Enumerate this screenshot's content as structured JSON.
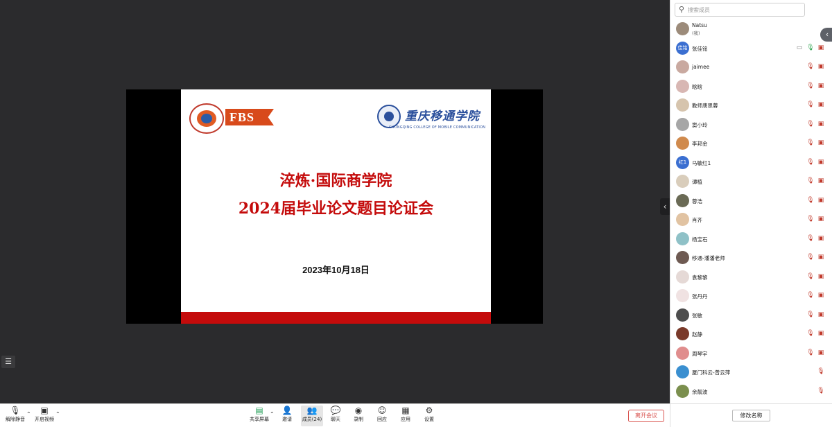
{
  "slide": {
    "fbs_logo_text": "FBS",
    "college_name": "重庆移通学院",
    "college_subtitle": "CHONGQING COLLEGE OF MOBILE COMMUNICATION",
    "title_line1": "淬炼·国际商学院",
    "title_line2": "2024届毕业论文题目论证会",
    "date": "2023年10月18日"
  },
  "panel": {
    "search_placeholder": "搜索成员",
    "members": [
      {
        "name": "Natsu",
        "sub": "(我)",
        "avatar_text": "",
        "avatar_color": "#9c8b7a",
        "mic": "none",
        "cam": "none"
      },
      {
        "name": "张佳铭",
        "avatar_text": "佳铭",
        "avatar_color": "#3b6fd1",
        "mic": "on",
        "cam": "off",
        "share": "screen-icon"
      },
      {
        "name": "jaimee",
        "avatar_text": "",
        "avatar_color": "#c9a9a0",
        "mic": "off",
        "cam": "off"
      },
      {
        "name": "晗晗",
        "avatar_text": "",
        "avatar_color": "#d8b7b3",
        "mic": "off",
        "cam": "off"
      },
      {
        "name": "教师唐思蓉",
        "avatar_text": "",
        "avatar_color": "#d6c4ad",
        "mic": "off",
        "cam": "off"
      },
      {
        "name": "窦小玲",
        "avatar_text": "",
        "avatar_color": "#a6a6a6",
        "mic": "off",
        "cam": "off"
      },
      {
        "name": "李邦金",
        "avatar_text": "",
        "avatar_color": "#d08a4d",
        "mic": "off",
        "cam": "off"
      },
      {
        "name": "马敏红1",
        "avatar_text": "红1",
        "avatar_color": "#3b6fd1",
        "mic": "off",
        "cam": "off"
      },
      {
        "name": "谭植",
        "avatar_text": "",
        "avatar_color": "#d9cdbb",
        "mic": "off",
        "cam": "off"
      },
      {
        "name": "蓉浩",
        "avatar_text": "",
        "avatar_color": "#6a6a55",
        "mic": "off",
        "cam": "off"
      },
      {
        "name": "肖齐",
        "avatar_text": "",
        "avatar_color": "#e1c3a2",
        "mic": "off",
        "cam": "off"
      },
      {
        "name": "杨宝石",
        "avatar_text": "",
        "avatar_color": "#8fc1c7",
        "mic": "off",
        "cam": "off"
      },
      {
        "name": "移通-潘潘老师",
        "avatar_text": "",
        "avatar_color": "#6e5a52",
        "mic": "off",
        "cam": "off"
      },
      {
        "name": "袁黎黎",
        "avatar_text": "",
        "avatar_color": "#e5d9d6",
        "mic": "off",
        "cam": "off"
      },
      {
        "name": "张丹丹",
        "avatar_text": "",
        "avatar_color": "#f0e2e2",
        "mic": "off",
        "cam": "off"
      },
      {
        "name": "张敏",
        "avatar_text": "",
        "avatar_color": "#4d4d4d",
        "mic": "off",
        "cam": "off"
      },
      {
        "name": "赵静",
        "avatar_text": "",
        "avatar_color": "#7a3a2a",
        "mic": "off",
        "cam": "off"
      },
      {
        "name": "周琴宇",
        "avatar_text": "",
        "avatar_color": "#e08d8d",
        "mic": "off",
        "cam": "off"
      },
      {
        "name": "厦门科云-曾云萍",
        "avatar_text": "",
        "avatar_color": "#3a8fd0",
        "mic": "off",
        "cam": "none"
      },
      {
        "name": "余靓波",
        "avatar_text": "",
        "avatar_color": "#7b8f4e",
        "mic": "off",
        "cam": "none"
      }
    ],
    "rename_label": "修改名称"
  },
  "toolbar": {
    "unmute_label": "解除静音",
    "start_video_label": "开启视频",
    "share_label": "共享屏幕",
    "invite_label": "邀请",
    "members_label": "成员(24)",
    "chat_label": "聊天",
    "record_label": "录制",
    "react_label": "回应",
    "apps_label": "应用",
    "settings_label": "设置",
    "leave_label": "离开会议"
  },
  "colors": {
    "accent_red": "#c40b0b",
    "college_blue": "#2a4f9c",
    "mic_on": "#2ea44f"
  }
}
